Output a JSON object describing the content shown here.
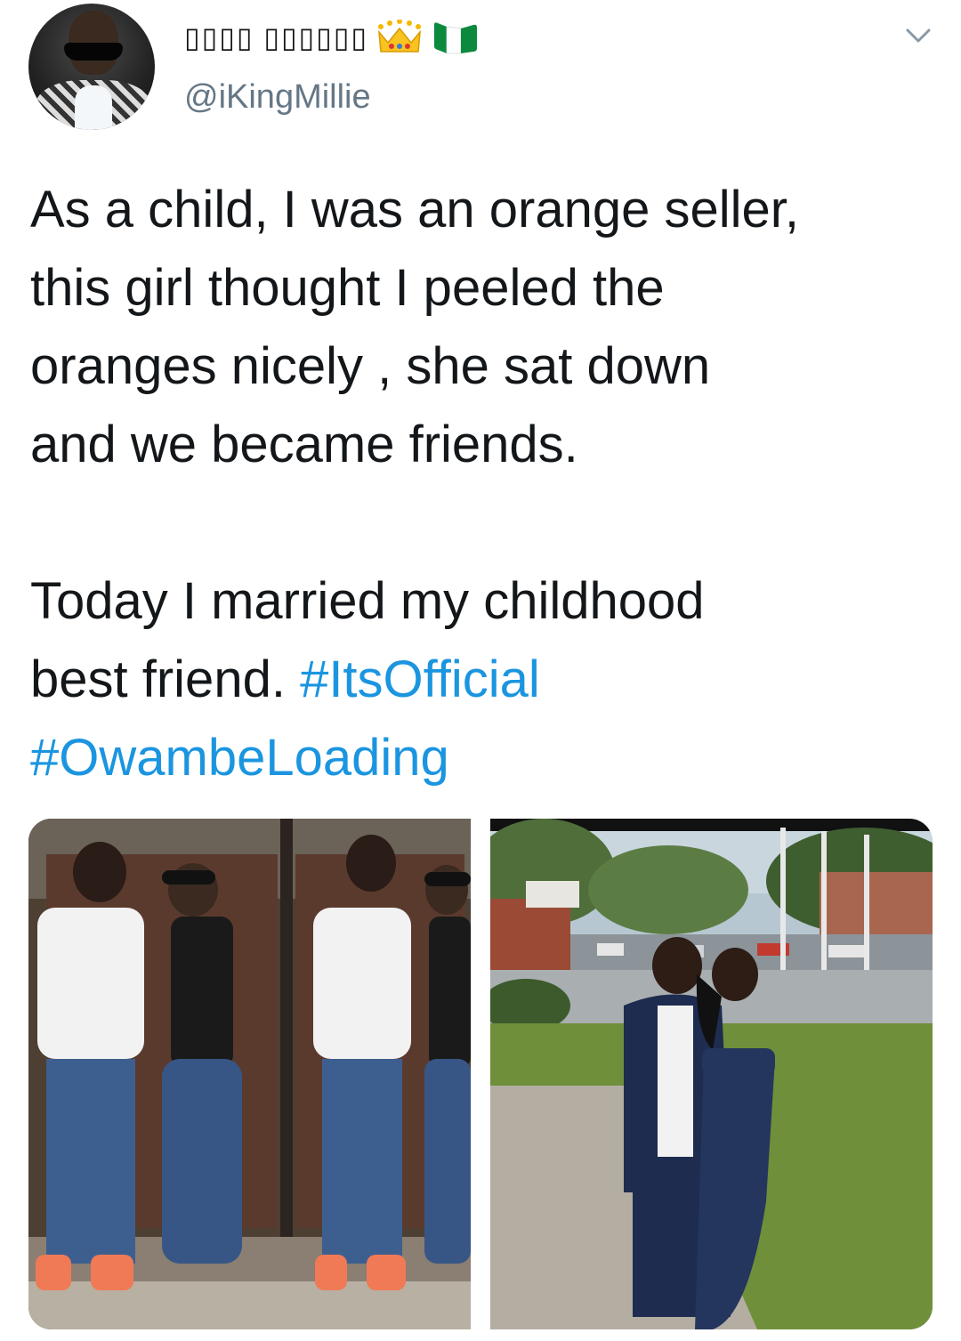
{
  "tweet": {
    "author": {
      "display_name": "▯▯▯▯ ▯▯▯▯▯▯",
      "handle": "@iKingMillie",
      "badges": [
        "crown-icon",
        "nigeria-flag-icon"
      ]
    },
    "menu_icon": "chevron-down-icon",
    "text": {
      "line1": "As a child, I was an orange seller,",
      "line2": "this girl thought I peeled the",
      "line3": "oranges nicely , she sat down",
      "line4": "and we became friends.",
      "line5": "Today I married my childhood",
      "line6_prefix": "best friend. ",
      "hashtag1": "#ItsOfficial",
      "hashtag2": "#OwambeLoading"
    },
    "colors": {
      "text": "#14171a",
      "secondary": "#657786",
      "hashtag": "#1b95e0"
    }
  }
}
